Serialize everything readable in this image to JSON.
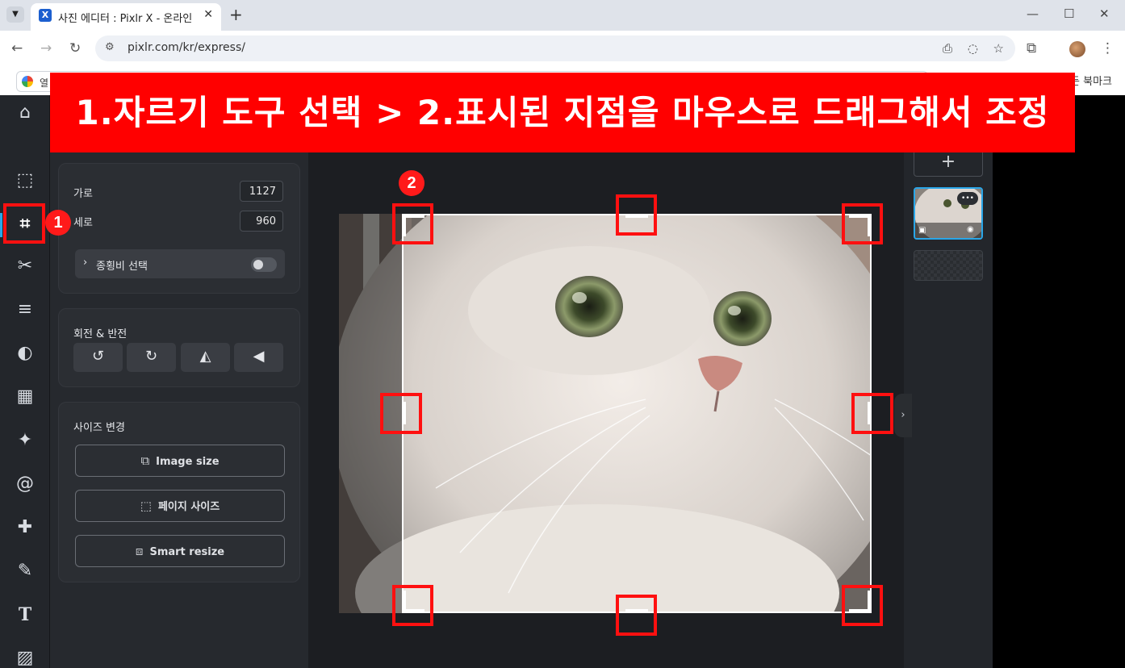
{
  "browser": {
    "tab_title": "사진 에디터 : Pixlr X - 온라인 ",
    "tab_favicon": "X",
    "url": "pixlr.com/kr/express/",
    "bookmark_partial": "열",
    "all_bookmarks": "든 북마크"
  },
  "banner": {
    "text": "1.자르기 도구 선택 > 2.표시된 지점을 마우스로 드래그해서 조정",
    "color": "#ff0000"
  },
  "badges": [
    "1",
    "2"
  ],
  "tools": [
    "home-icon",
    "arrange-icon",
    "crop-icon",
    "cutout-icon",
    "adjust-icon",
    "filter-icon",
    "effect-icon",
    "ai-sparkle-icon",
    "liquify-icon",
    "retouch-icon",
    "paint-icon",
    "text-icon",
    "pattern-icon"
  ],
  "crop_panel": {
    "width_label": "가로",
    "width_value": "1127",
    "height_label": "세로",
    "height_value": "960",
    "ratio_label": "종횡비 선택",
    "ratio_toggle_on": false
  },
  "rotate_panel": {
    "title": "회전 & 반전"
  },
  "resize_panel": {
    "title": "사이즈 변경",
    "image_size": "Image size",
    "page_size": "페이지 사이즈",
    "smart_resize": "Smart resize"
  },
  "layers": {
    "add": "+",
    "more": "•••"
  },
  "colors": {
    "accent": "#2aa6e8",
    "highlight": "#ff1010"
  }
}
